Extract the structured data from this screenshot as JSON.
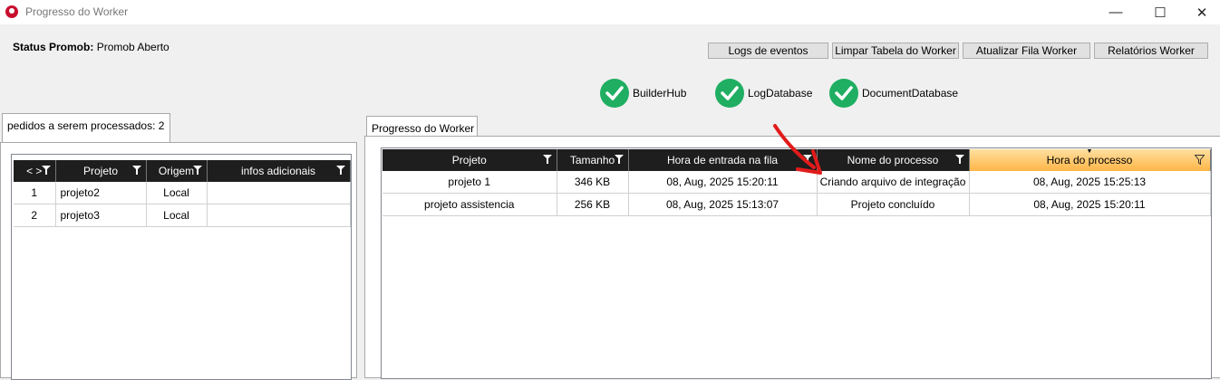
{
  "window": {
    "title": "Progresso do Worker",
    "controls": {
      "minimize": "—",
      "maximize": "☐",
      "close": "✕"
    }
  },
  "status": {
    "label": "Status Promob:",
    "value": "Promob Aberto"
  },
  "toolbar": {
    "logs": "Logs de eventos",
    "clear": "Limpar Tabela do Worker",
    "refresh": "Atualizar Fila Worker",
    "reports": "Relatórios Worker"
  },
  "services": [
    {
      "name": "BuilderHub",
      "ok": true
    },
    {
      "name": "LogDatabase",
      "ok": true
    },
    {
      "name": "DocumentDatabase",
      "ok": true
    }
  ],
  "left_tab": {
    "label": "pedidos a serem processados: 2",
    "columns": [
      "< >",
      "Projeto",
      "Origem",
      "infos adicionais"
    ],
    "rows": [
      {
        "n": "1",
        "projeto": "projeto2",
        "origem": "Local",
        "infos": ""
      },
      {
        "n": "2",
        "projeto": "projeto3",
        "origem": "Local",
        "infos": ""
      }
    ]
  },
  "right_tab": {
    "label": "Progresso do Worker",
    "columns": [
      "Projeto",
      "Tamanho",
      "Hora de entrada na fila",
      "Nome do processo",
      "Hora do processo"
    ],
    "rows": [
      {
        "projeto": "projeto 1",
        "tamanho": "346 KB",
        "entrada": "08, Aug, 2025 15:20:11",
        "processo": "Criando arquivo de integração",
        "hora": "08, Aug, 2025 15:25:13"
      },
      {
        "projeto": "projeto assistencia",
        "tamanho": "256 KB",
        "entrada": "08, Aug, 2025 15:13:07",
        "processo": "Projeto concluído",
        "hora": "08, Aug, 2025 15:20:11"
      }
    ]
  },
  "colors": {
    "check": "#1fae62",
    "header": "#1e1e1e",
    "selected_header": "#ffb547",
    "arrow": "#e21b1b"
  }
}
